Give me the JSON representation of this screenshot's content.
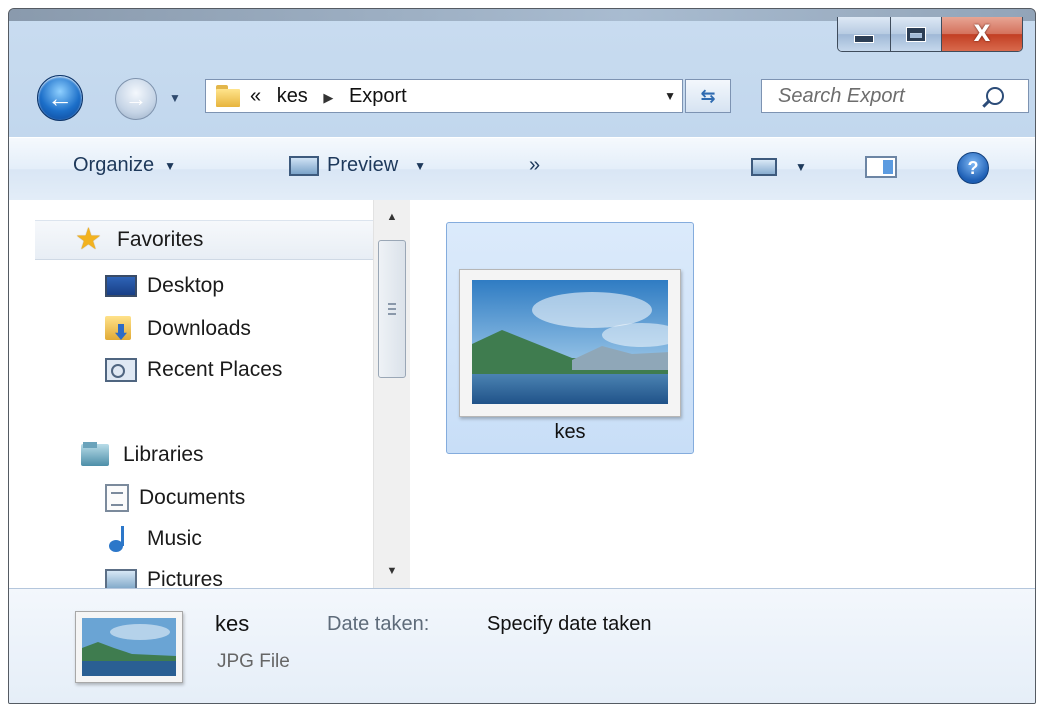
{
  "window": {
    "minimize_label": "—",
    "maximize_label": "",
    "close_label": "X"
  },
  "nav": {
    "back_glyph": "←",
    "forward_glyph": "→",
    "breadcrumb_overflow": "«",
    "breadcrumb": [
      "kes",
      "Export"
    ],
    "breadcrumb_sep": "▶",
    "refresh_glyph": "⇆",
    "search_placeholder": "Search Export"
  },
  "toolbar": {
    "organize": "Organize",
    "preview": "Preview",
    "more": "»",
    "help": "?"
  },
  "sidebar": {
    "favorites": {
      "label": "Favorites",
      "icon": "star-icon",
      "items": [
        {
          "label": "Desktop",
          "icon": "desktop-icon"
        },
        {
          "label": "Downloads",
          "icon": "downloads-icon"
        },
        {
          "label": "Recent Places",
          "icon": "recent-places-icon"
        }
      ]
    },
    "libraries": {
      "label": "Libraries",
      "icon": "libraries-icon",
      "items": [
        {
          "label": "Documents",
          "icon": "documents-icon"
        },
        {
          "label": "Music",
          "icon": "music-icon"
        },
        {
          "label": "Pictures",
          "icon": "pictures-icon"
        }
      ]
    }
  },
  "files": [
    {
      "name": "kes",
      "selected": true
    }
  ],
  "details": {
    "name": "kes",
    "type": "JPG File",
    "date_label": "Date taken:",
    "date_value": "Specify date taken"
  },
  "colors": {
    "accent": "#1c6fc9",
    "selection": "#cfe3fb",
    "close_button": "#c23e23"
  }
}
